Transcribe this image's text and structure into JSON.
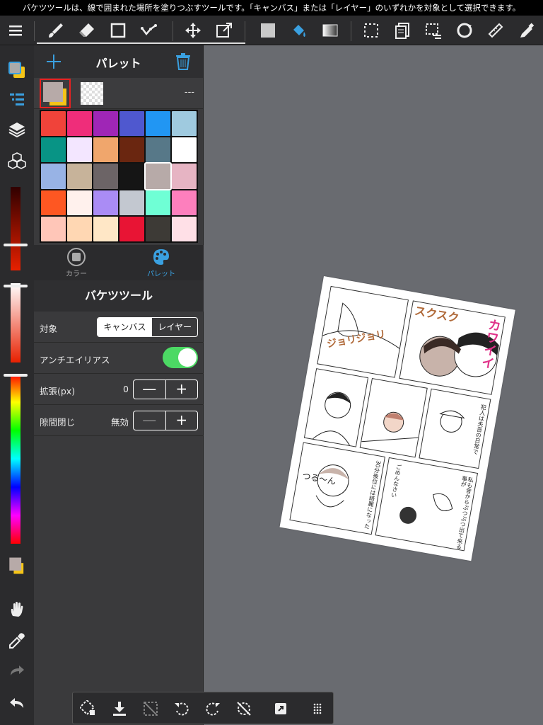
{
  "status_bar": {
    "text": "バケツツールは、線で囲まれた場所を塗りつぶすツールです。「キャンバス」または「レイヤー」のいずれかを対象として選択できます。"
  },
  "panel": {
    "title": "パレット",
    "add_icon": "plus-icon",
    "trash_icon": "trash-icon",
    "swatch_value": "---",
    "tabs": [
      {
        "label": "カラー",
        "icon": "color-tab-icon"
      },
      {
        "label": "パレット",
        "icon": "palette-tab-icon"
      }
    ],
    "active_tab": "パレット",
    "palette_colors": [
      "#f0433a",
      "#ef2d7a",
      "#9f26b6",
      "#4f58cf",
      "#2196f3",
      "#9fcadf",
      "#089485",
      "#f3e6ff",
      "#f0a66c",
      "#6a2610",
      "#577888",
      "#ffffff",
      "#98b3e5",
      "#c7b39a",
      "#6c6466",
      "#151515",
      "#b7aaa8",
      "#e6b4c3",
      "#fe5722",
      "#fff1ed",
      "#aa8cf5",
      "#c3c8d0",
      "#6fffd5",
      "#fd7fbd",
      "#ffc6b8",
      "#ffd7b3",
      "#ffe7c6",
      "#e81434",
      "#3d3a36",
      "#ffe0e7"
    ],
    "selected_color_index": 16,
    "palette_colors_visible_note": ""
  },
  "tool": {
    "title": "バケツツール",
    "target_label": "対象",
    "target_options": [
      "キャンバス",
      "レイヤー"
    ],
    "target_selected": "キャンバス",
    "antialias_label": "アンチエイリアス",
    "antialias_on": true,
    "expand_label": "拡張(px)",
    "expand_value": "0",
    "gap_label": "隙間閉じ",
    "gap_value": "無効",
    "minus": "—",
    "plus": "+"
  },
  "manga": {
    "sfx_top": "ジョリジョリ",
    "sfx_right": "カワイイ",
    "sfx_scr": "スクスク",
    "text_1": "犯人は夫吾の日常で",
    "text_2": "30分後位には綺麗になった",
    "text_3": "ごめんなさい",
    "text_4": "私も昔からぷつぷつ出て来る事が",
    "sfx_tsuru": "つる〜ん"
  },
  "colors": {
    "accent": "#3aa0e0",
    "toggle_on": "#4cd964",
    "primary_swatch": "#b7aaa8",
    "secondary_swatch": "#f5c518"
  }
}
